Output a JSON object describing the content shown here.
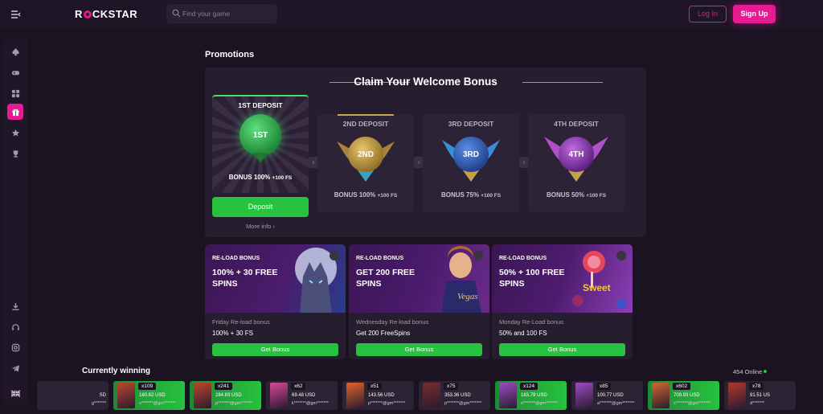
{
  "header": {
    "logo_text_pre": "R",
    "logo_text_post": "CKSTAR",
    "search_placeholder": "Find your game",
    "login_label": "Log In",
    "signup_label": "Sign Up"
  },
  "sidebar": {
    "items": [
      "spade-icon",
      "gamepad-icon",
      "grid-icon",
      "gift-icon",
      "star-icon",
      "trophy-icon",
      "download-icon",
      "headset-icon",
      "instagram-icon",
      "telegram-icon",
      "flag-uk-icon"
    ]
  },
  "main": {
    "title": "Promotions",
    "welcome": {
      "title": "Claim Your Welcome Bonus",
      "deposits": [
        {
          "label": "1ST DEPOSIT",
          "medal": "1ST",
          "bonus": "BONUS 100%",
          "fs": "+100 FS",
          "color": "#2fa84a"
        },
        {
          "label": "2ND DEPOSIT",
          "medal": "2ND",
          "bonus": "BONUS 100%",
          "fs": "+100 FS",
          "color": "#b8923a"
        },
        {
          "label": "3RD DEPOSIT",
          "medal": "3RD",
          "bonus": "BONUS 75%",
          "fs": "+100 FS",
          "color": "#2e67c7"
        },
        {
          "label": "4TH DEPOSIT",
          "medal": "4TH",
          "bonus": "BONUS 50%",
          "fs": "+100 FS",
          "color": "#8a3fb3"
        }
      ],
      "deposit_button": "Deposit",
      "more_info": "More info ›"
    },
    "promos": [
      {
        "tag": "RE-LOAD BONUS",
        "headline": "100% + 30 FREE SPINS",
        "subtitle": "Friday Re-load bonus",
        "value": "100% + 30 FS",
        "button": "Get Bonus"
      },
      {
        "tag": "RE-LOAD BONUS",
        "headline": "GET 200 FREE SPINS",
        "subtitle": "Wednesday Re-load bonus",
        "value": "Get 200 FreeSpins",
        "button": "Get Bonus"
      },
      {
        "tag": "RE-LOAD BONUS",
        "headline": "50% + 100 FREE SPINS",
        "subtitle": "Monday Re-Load bonus",
        "value": "50% and 100 FS",
        "button": "Get Bonus"
      }
    ]
  },
  "winners": {
    "title": "Currently winning",
    "online": "454 Online",
    "items": [
      {
        "mult": "",
        "amount": "SD",
        "user": "g*******",
        "style": "dark",
        "thumb": "#6b2a3a"
      },
      {
        "mult": "x109",
        "amount": "180.82 USD",
        "user": "s*******@gm*******",
        "style": "green",
        "thumb": "#c0462c"
      },
      {
        "mult": "x241",
        "amount": "284.83 USD",
        "user": "p*******@gm*******",
        "style": "green",
        "thumb": "#c0462c"
      },
      {
        "mult": "x62",
        "amount": "69.48 USD",
        "user": "k*******@gm*******",
        "style": "dark",
        "thumb": "#d9479a"
      },
      {
        "mult": "x51",
        "amount": "143.56 USD",
        "user": "p*******@gm*******",
        "style": "dark",
        "thumb": "#e0642a"
      },
      {
        "mult": "x75",
        "amount": "353.36 USD",
        "user": "p*******@gm*******",
        "style": "dark",
        "thumb": "#7a2e2e"
      },
      {
        "mult": "x124",
        "amount": "183.79 USD",
        "user": "s*******@gm*******",
        "style": "green",
        "thumb": "#9e4cc4"
      },
      {
        "mult": "x85",
        "amount": "100.77 USD",
        "user": "a*******@gm*******",
        "style": "dark",
        "thumb": "#9e4cc4"
      },
      {
        "mult": "x602",
        "amount": "709.93 USD",
        "user": "s*******@gm*******",
        "style": "green",
        "thumb": "#d06a2e"
      },
      {
        "mult": "x78",
        "amount": "91.51 US",
        "user": "d*******",
        "style": "dark",
        "thumb": "#b5382e"
      }
    ]
  }
}
